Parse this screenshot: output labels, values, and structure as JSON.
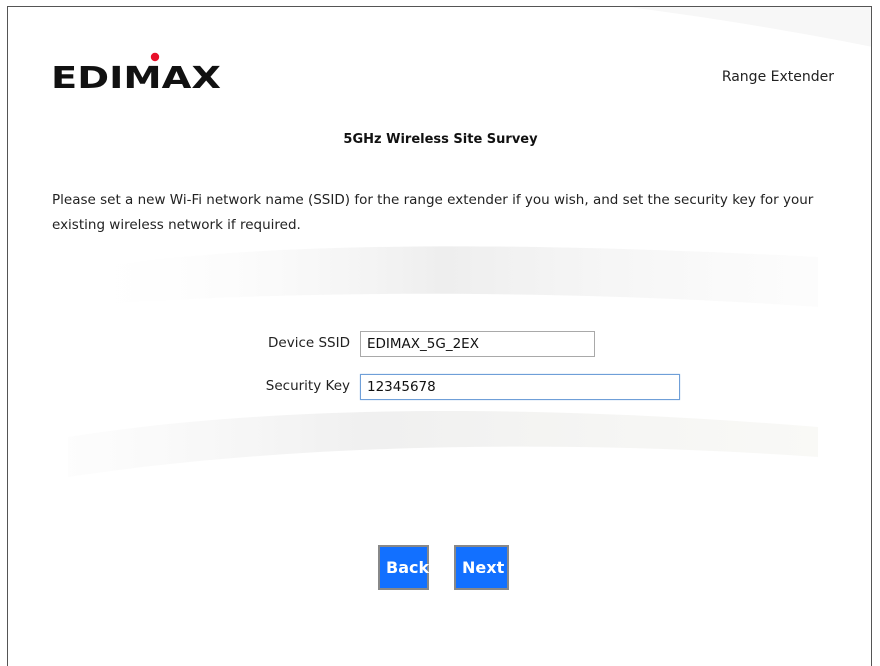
{
  "header": {
    "brand": "EDIMAX",
    "product": "Range Extender"
  },
  "page": {
    "title": "5GHz Wireless Site Survey",
    "intro": "Please set a new Wi-Fi network name (SSID) for the range extender if you wish, and set the security key for your existing wireless network if required."
  },
  "form": {
    "ssid": {
      "label": "Device SSID",
      "value": "EDIMAX_5G_2EX"
    },
    "key": {
      "label": "Security Key",
      "value": "12345678"
    }
  },
  "buttons": {
    "back": "Back",
    "next": "Next"
  },
  "colors": {
    "button": "#1270ff",
    "logo_dot": "#e8102a",
    "logo_text": "#111111",
    "swoosh": "#f4f4f4"
  }
}
